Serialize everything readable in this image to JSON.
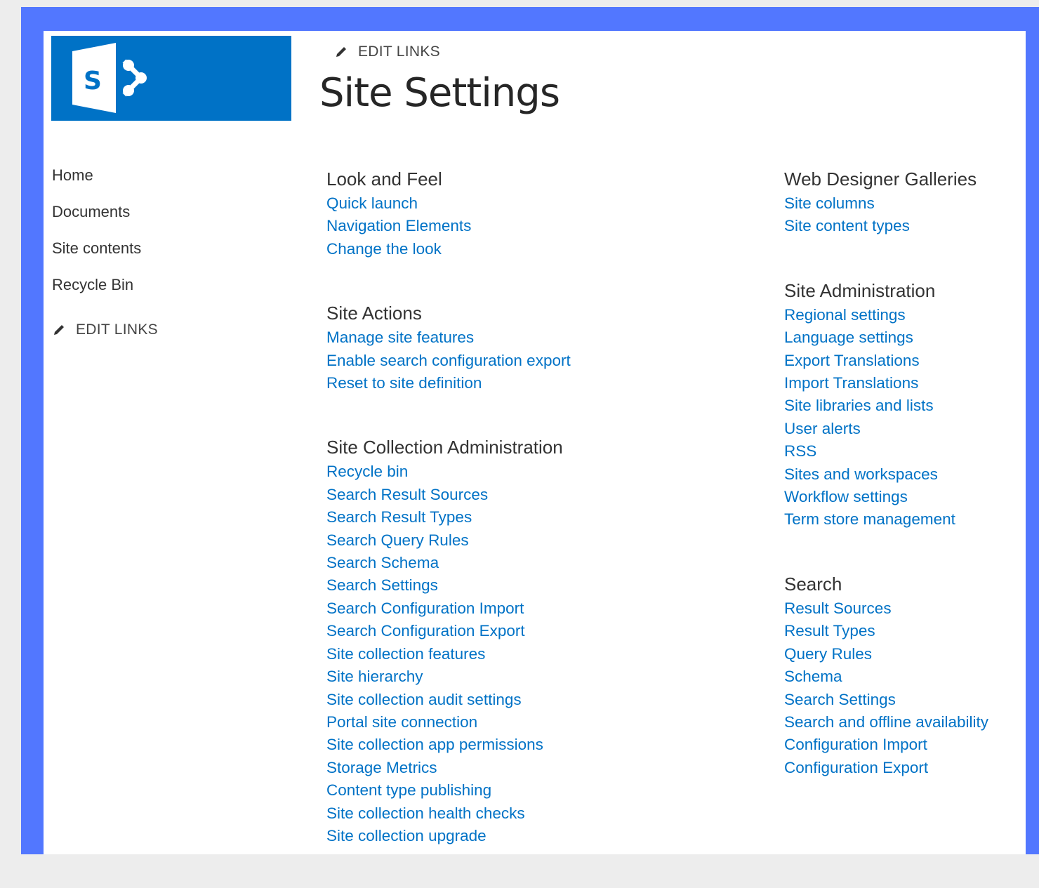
{
  "header": {
    "edit_links": "EDIT LINKS",
    "title": "Site Settings"
  },
  "leftnav": {
    "items": [
      {
        "label": "Home"
      },
      {
        "label": "Documents"
      },
      {
        "label": "Site contents"
      },
      {
        "label": "Recycle Bin"
      }
    ],
    "edit_links": "EDIT LINKS"
  },
  "sections": {
    "look_and_feel": {
      "title": "Look and Feel",
      "links": [
        "Quick launch",
        "Navigation Elements",
        "Change the look"
      ]
    },
    "site_actions": {
      "title": "Site Actions",
      "links": [
        "Manage site features",
        "Enable search configuration export",
        "Reset to site definition"
      ]
    },
    "site_collection_admin": {
      "title": "Site Collection Administration",
      "links": [
        "Recycle bin",
        "Search Result Sources",
        "Search Result Types",
        "Search Query Rules",
        "Search Schema",
        "Search Settings",
        "Search Configuration Import",
        "Search Configuration Export",
        "Site collection features",
        "Site hierarchy",
        "Site collection audit settings",
        "Portal site connection",
        "Site collection app permissions",
        "Storage Metrics",
        "Content type publishing",
        "Site collection health checks",
        "Site collection upgrade"
      ]
    },
    "web_designer_galleries": {
      "title": "Web Designer Galleries",
      "links": [
        "Site columns",
        "Site content types"
      ]
    },
    "site_administration": {
      "title": "Site Administration",
      "links": [
        "Regional settings",
        "Language settings",
        "Export Translations",
        "Import Translations",
        "Site libraries and lists",
        "User alerts",
        "RSS",
        "Sites and workspaces",
        "Workflow settings",
        "Term store management"
      ]
    },
    "search": {
      "title": "Search",
      "links": [
        "Result Sources",
        "Result Types",
        "Query Rules",
        "Schema",
        "Search Settings",
        "Search and offline availability",
        "Configuration Import",
        "Configuration Export"
      ]
    }
  },
  "colors": {
    "brand": "#0072c6",
    "frame": "#5277ff",
    "link": "#0072c6"
  }
}
